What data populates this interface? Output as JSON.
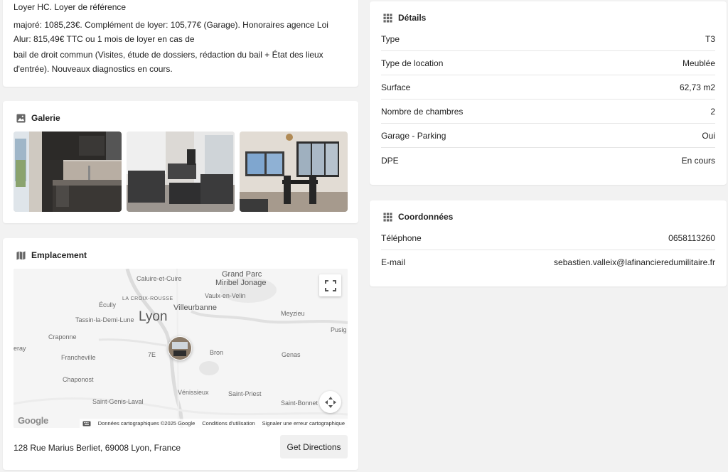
{
  "description": {
    "lines": [
      "Loyer HC. Loyer de référence",
      "majoré: 1085,23€. Complément de loyer: 105,77€ (Garage). Honoraires agence Loi Alur: 815,49€ TTC ou 1 mois de loyer en cas de",
      "bail de droit commun (Visites, étude de dossiers, rédaction du bail + État des lieux d'entrée). Nouveaux diagnostics en cours."
    ]
  },
  "galerie": {
    "title": "Galerie",
    "icon": "image-icon"
  },
  "emplacement": {
    "title": "Emplacement",
    "icon": "map-icon",
    "address": "128 Rue Marius Berliet, 69008 Lyon, France",
    "directions_label": "Get Directions",
    "map": {
      "labels": {
        "caluire": "Caluire-et-Cuire",
        "grand_parc": "Grand Parc",
        "miribel": "Miribel Jonage",
        "croix_rousse": "LA CROIX-ROUSSE",
        "vaulx": "Vaulx-en-Velin",
        "ecully": "Écully",
        "villeurbanne": "Villeurbanne",
        "lyon": "Lyon",
        "tassin": "Tassin-la-Demi-Lune",
        "meyzieu": "Meyzieu",
        "pusig": "Pusig",
        "craponne": "Craponne",
        "eray": "eray",
        "francheville": "Francheville",
        "septieme": "7E",
        "bron": "Bron",
        "genas": "Genas",
        "chaponost": "Chaponost",
        "venissieux": "Vénissieux",
        "saint_priest": "Saint-Priest",
        "saint_genis": "Saint-Genis-Laval",
        "saint_bonnet": "Saint-Bonnet"
      },
      "logo": "Google",
      "footer": {
        "data": "Données cartographiques ©2025 Google",
        "terms": "Conditions d'utilisation",
        "report": "Signaler une erreur cartographique"
      }
    }
  },
  "details": {
    "title": "Détails",
    "icon": "grid-icon",
    "rows": [
      {
        "label": "Type",
        "value": "T3"
      },
      {
        "label": "Type de location",
        "value": "Meublée"
      },
      {
        "label": "Surface",
        "value": "62,73 m2"
      },
      {
        "label": "Nombre de chambres",
        "value": "2"
      },
      {
        "label": "Garage - Parking",
        "value": "Oui"
      },
      {
        "label": "DPE",
        "value": "En cours"
      }
    ]
  },
  "coordonnees": {
    "title": "Coordonnées",
    "icon": "grid-icon",
    "rows": [
      {
        "label": "Téléphone",
        "value": "0658113260"
      },
      {
        "label": "E-mail",
        "value": "sebastien.valleix@lafinancieredumilitaire.fr"
      }
    ]
  }
}
